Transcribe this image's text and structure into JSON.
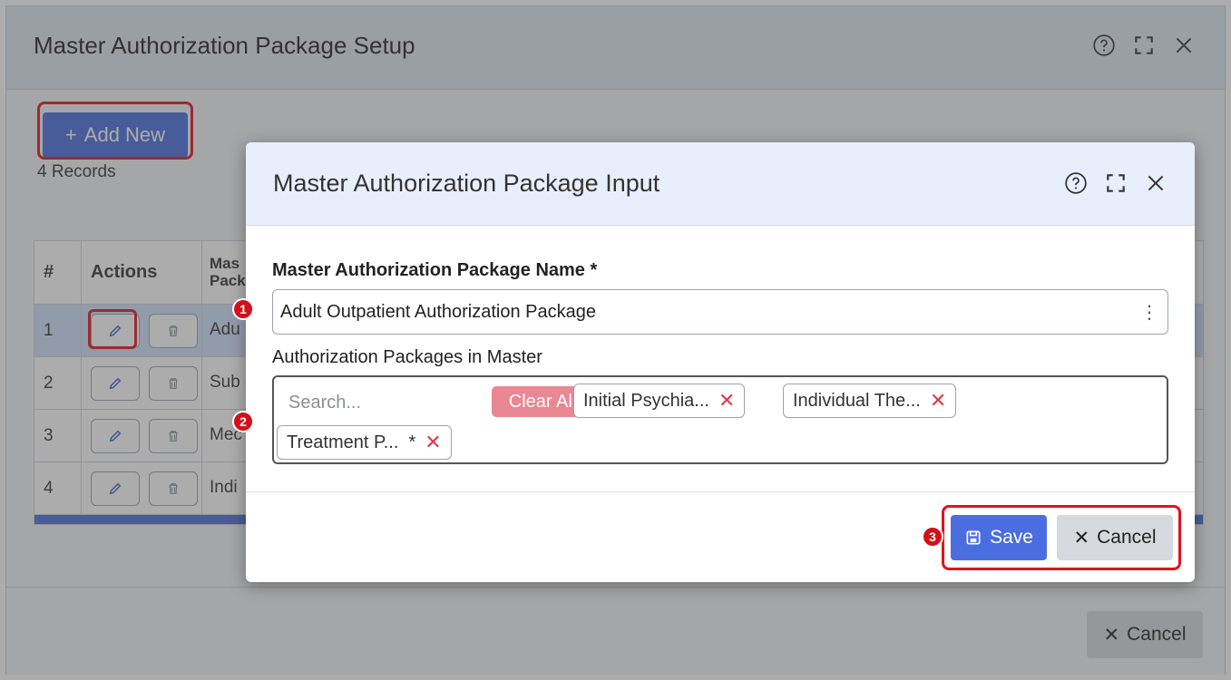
{
  "outer": {
    "title": "Master Authorization Package Setup",
    "add_new_label": "Add New",
    "records_text": "4 Records",
    "grid": {
      "headers": {
        "num": "#",
        "actions": "Actions",
        "name": "Mas\nPack"
      },
      "rows": [
        {
          "num": "1",
          "name": "Adu"
        },
        {
          "num": "2",
          "name": "Sub"
        },
        {
          "num": "3",
          "name": "Mec"
        },
        {
          "num": "4",
          "name": "Indi"
        }
      ]
    },
    "cancel_label": "Cancel"
  },
  "modal": {
    "title": "Master Authorization Package Input",
    "name_label": "Master Authorization Package Name *",
    "name_value": "Adult Outpatient Authorization Package",
    "packages_label": "Authorization Packages in Master",
    "search_placeholder": "Search...",
    "clear_all_label": "Clear All",
    "chips": [
      {
        "label": "Initial Psychia..."
      },
      {
        "label": "Individual The..."
      },
      {
        "label": "Treatment P...  *"
      }
    ],
    "save_label": "Save",
    "cancel_label": "Cancel"
  },
  "badges": [
    "1",
    "2",
    "3"
  ],
  "colors": {
    "primary": "#4a6ee0",
    "highlight": "#e0141b",
    "clear_all": "#e98792",
    "remove_x": "#e03a4a"
  }
}
